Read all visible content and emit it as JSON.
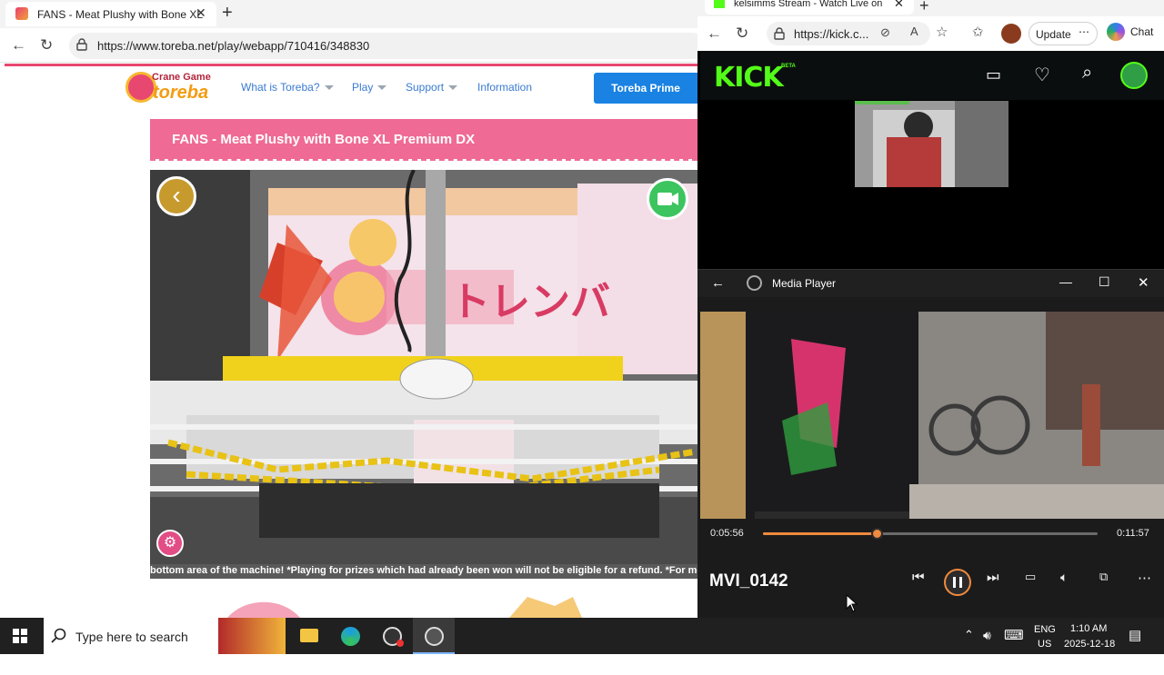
{
  "left_browser": {
    "tab_title": "FANS - Meat Plushy with Bone XL",
    "url": "https://www.toreba.net/play/webapp/710416/348830",
    "site": {
      "logo_small": "Crane Game",
      "logo_big": "toreba",
      "nav": [
        "What is Toreba?",
        "Play",
        "Support",
        "Information"
      ],
      "prime_button": "Toreba Prime",
      "product_title": "FANS - Meat Plushy with Bone XL Premium DX",
      "ticker": "bottom area of the machine! *Playing for prizes which had already been won will not be eligible for a refund. *For more info"
    }
  },
  "right_browser": {
    "tab_title": "kelsimms Stream - Watch Live on",
    "url": "https://kick.c...",
    "update_label": "Update",
    "chat_label": "Chat",
    "kick_logo": "KICK",
    "kick_beta": "BETA"
  },
  "media_player": {
    "title": "Media Player",
    "elapsed": "0:05:56",
    "remaining": "0:11:57",
    "progress": 0.34,
    "clip_name": "MVI_0142"
  },
  "taskbar": {
    "search_placeholder": "Type here to search",
    "lang_top": "ENG",
    "lang_bottom": "US",
    "time": "1:10 AM",
    "date": "2025-12-18"
  },
  "colors": {
    "toreba_pink": "#ef6a94",
    "toreba_blue": "#1a82e2",
    "kick_green": "#53fc18",
    "player_accent": "#f08a3e"
  }
}
